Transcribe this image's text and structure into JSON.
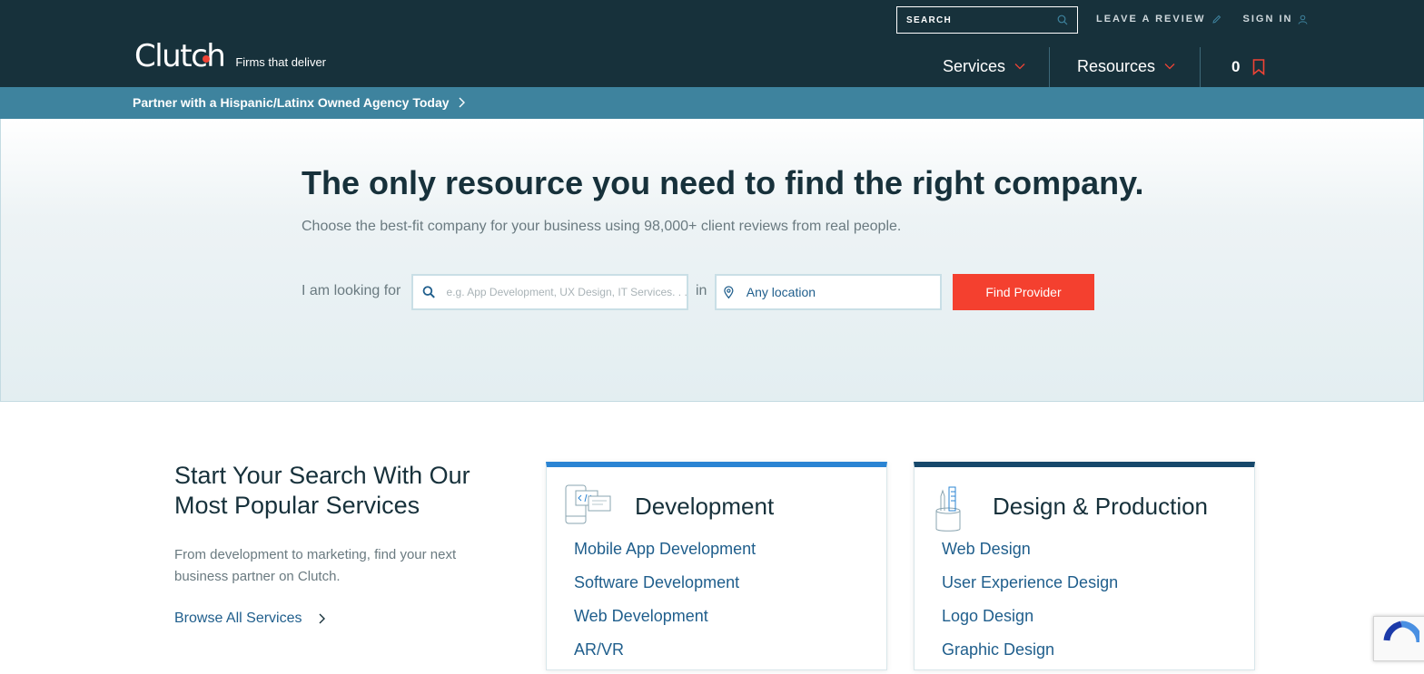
{
  "header": {
    "logo_text": "Clutch",
    "tagline": "Firms that deliver",
    "search_placeholder": "SEARCH",
    "leave_review": "LEAVE A REVIEW",
    "sign_in": "SIGN IN",
    "nav": [
      {
        "label": "Services"
      },
      {
        "label": "Resources"
      }
    ],
    "bookmark_count": "0"
  },
  "promo": {
    "text": "Partner with a Hispanic/Latinx Owned Agency Today"
  },
  "hero": {
    "title": "The only resource you need to find the right company.",
    "subtitle": "Choose the best-fit company for your business using 98,000+ client reviews from real people.",
    "looking_for": "I am looking for",
    "service_placeholder": "e.g. App Development, UX Design, IT Services. . .",
    "in_label": "in",
    "location_value": "Any location",
    "find_button": "Find Provider"
  },
  "popular": {
    "title": "Start Your Search With Our Most Popular Services",
    "description": "From development to marketing, find your next business partner on Clutch.",
    "browse_all": "Browse All Services"
  },
  "cards": [
    {
      "title": "Development",
      "icon": "code-devices-icon",
      "accent": "#2b84d3",
      "links": [
        "Mobile App Development",
        "Software Development",
        "Web Development",
        "AR/VR"
      ]
    },
    {
      "title": "Design & Production",
      "icon": "design-tools-icon",
      "accent": "#17486b",
      "links": [
        "Web Design",
        "User Experience Design",
        "Logo Design",
        "Graphic Design"
      ]
    }
  ],
  "colors": {
    "header_bg": "#17313b",
    "promo_bg": "#3e839e",
    "cta": "#f4402f",
    "link": "#1f5e8c",
    "brand_dot": "#ef4335"
  }
}
